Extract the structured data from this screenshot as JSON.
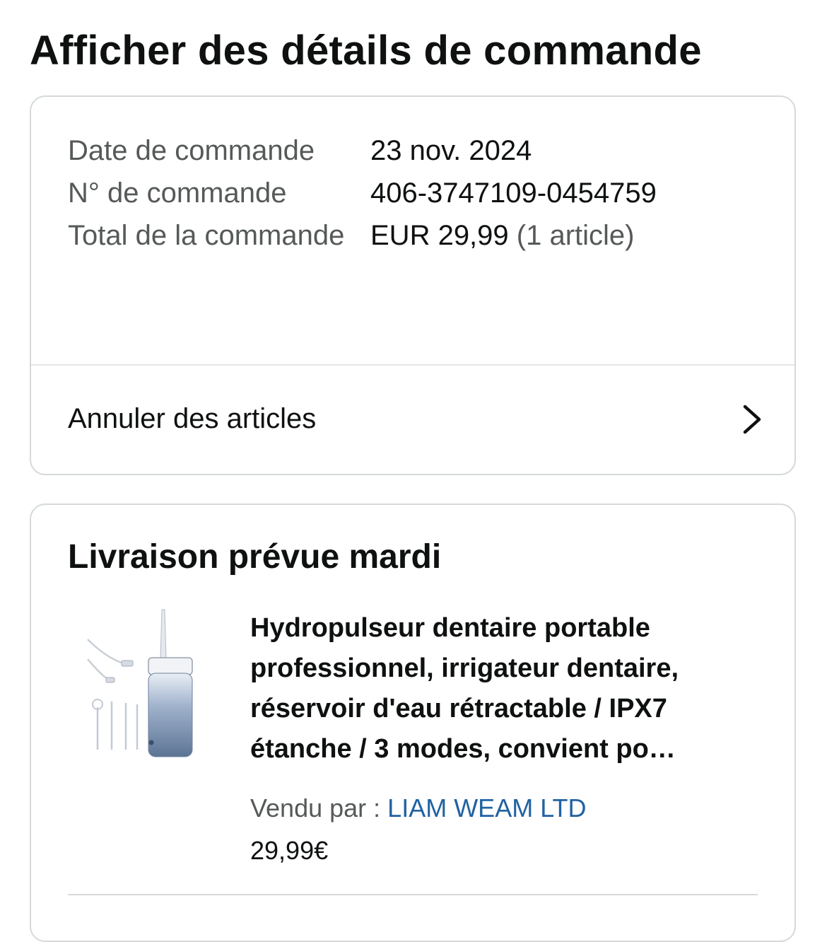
{
  "page": {
    "title": "Afficher des détails de commande"
  },
  "summary": {
    "order_date_label": "Date de commande",
    "order_date_value": "23 nov. 2024",
    "order_number_label": "N° de commande",
    "order_number_value": "406-3747109-0454759",
    "order_total_label": "Total de la commande",
    "order_total_value": "EUR 29,99",
    "order_total_count": "(1 article)",
    "cancel_label": "Annuler des articles",
    "cancel_icon": "chevron-right-icon"
  },
  "delivery": {
    "title": "Livraison prévue mardi",
    "product": {
      "title": "Hydropulseur dentaire portable professionnel, irrigateur dentaire, réservoir d'eau rétractable / IPX7 étanche / 3 modes, convient po…",
      "seller_label": "Vendu par  :",
      "seller_name": "LIAM WEAM LTD",
      "price": "29,99€",
      "image_icon": "water-flosser-product-image"
    }
  },
  "colors": {
    "text_primary": "#0f1111",
    "text_secondary": "#565959",
    "link": "#2162a1",
    "border": "#d5d9d9"
  }
}
